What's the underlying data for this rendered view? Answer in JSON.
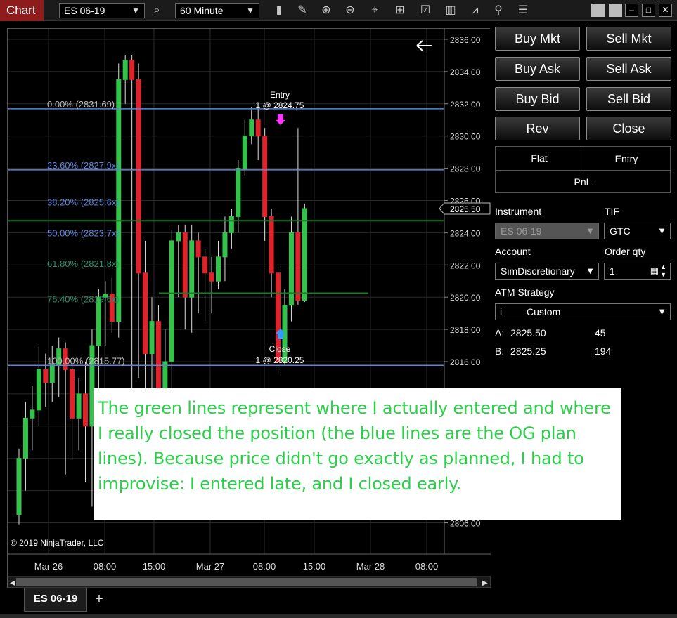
{
  "toolbar": {
    "title": "Chart",
    "instrument": "ES 06-19",
    "interval": "60 Minute",
    "icons": [
      "search-icon",
      "bar-chart-icon",
      "pencil-icon",
      "zoom-in-icon",
      "zoom-out-icon",
      "crosshair-icon",
      "data-box-icon",
      "properties-icon",
      "strategies-icon",
      "indicators-icon",
      "templates-icon",
      "list-icon"
    ]
  },
  "window": {
    "minimize": "–",
    "maximize": "□",
    "close": "✕"
  },
  "chart": {
    "copyright": "© 2019 NinjaTrader, LLC",
    "current_price": "2825.50",
    "price_axis": [
      "2836.00",
      "2834.00",
      "2832.00",
      "2830.00",
      "2828.00",
      "2826.00",
      "2824.00",
      "2822.00",
      "2820.00",
      "2818.00",
      "2816.00",
      "2806.00"
    ],
    "time_axis": [
      "Mar 26",
      "08:00",
      "15:00",
      "Mar 27",
      "08:00",
      "15:00",
      "Mar 28",
      "08:00"
    ],
    "fib_levels": [
      {
        "label": "0.00% (2831.69)",
        "price": 2831.69
      },
      {
        "label": "23.60% (2827.9x)",
        "price": 2827.9
      },
      {
        "label": "38.20% (2825.6x)",
        "price": 2825.6
      },
      {
        "label": "50.00% (2823.7x)",
        "price": 2823.7
      },
      {
        "label": "61.80% (2821.8x)",
        "price": 2821.8
      },
      {
        "label": "76.40% (2819.6x)",
        "price": 2819.6
      },
      {
        "label": "100.00% (2815.77)",
        "price": 2815.77
      }
    ],
    "entry": {
      "title": "Entry",
      "detail": "1 @ 2824.75"
    },
    "close": {
      "title": "Close",
      "detail": "1 @ 2820.25"
    },
    "colors": {
      "up": "#33c24a",
      "down": "#e0222a",
      "fib": "#5b84e0",
      "actual": "#1d7a2a"
    }
  },
  "trader": {
    "buttons": [
      {
        "key": "buy-mkt",
        "label": "Buy Mkt"
      },
      {
        "key": "sell-mkt",
        "label": "Sell Mkt"
      },
      {
        "key": "buy-ask",
        "label": "Buy Ask"
      },
      {
        "key": "sell-ask",
        "label": "Sell Ask"
      },
      {
        "key": "buy-bid",
        "label": "Buy Bid"
      },
      {
        "key": "sell-bid",
        "label": "Sell Bid"
      },
      {
        "key": "rev",
        "label": "Rev"
      },
      {
        "key": "close",
        "label": "Close"
      }
    ],
    "position": {
      "flat": "Flat",
      "entry": "Entry",
      "pnl": "PnL"
    },
    "instrument_label": "Instrument",
    "instrument_value": "ES 06-19",
    "tif_label": "TIF",
    "tif_value": "GTC",
    "account_label": "Account",
    "account_value": "SimDiscretionary",
    "qty_label": "Order qty",
    "qty_value": "1",
    "atm_label": "ATM Strategy",
    "atm_value": "Custom",
    "ask_label": "A:",
    "ask_price": "2825.50",
    "ask_size": "45",
    "bid_label": "B:",
    "bid_price": "2825.25",
    "bid_size": "194"
  },
  "bottom": {
    "tab": "ES 06-19",
    "add": "+"
  },
  "note": {
    "text": "The green lines represent where I actually entered and where I really closed the position (the blue lines are the OG plan lines). Because price didn't go exactly as planned, I had to improvise: I entered late, and I closed early."
  }
}
